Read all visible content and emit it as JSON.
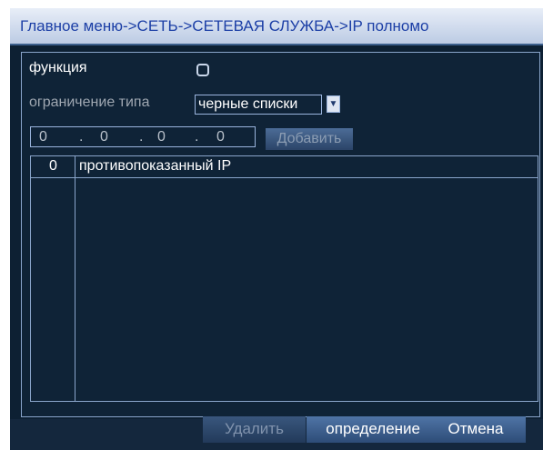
{
  "title": "Главное меню->СЕТЬ->СЕТЕВАЯ СЛУЖБА->IP полномо",
  "function": {
    "label": "функция",
    "enabled": false
  },
  "restriction": {
    "label": "ограничение типа",
    "selected": "черные списки"
  },
  "ip_input": {
    "octets": [
      "0",
      "0",
      "0",
      "0"
    ],
    "add_label": "Добавить"
  },
  "list": {
    "col_num": "0",
    "col_ip": "противопоказанный IP",
    "rows": []
  },
  "buttons": {
    "delete": "Удалить",
    "ok": "определение",
    "cancel": "Отмена"
  }
}
